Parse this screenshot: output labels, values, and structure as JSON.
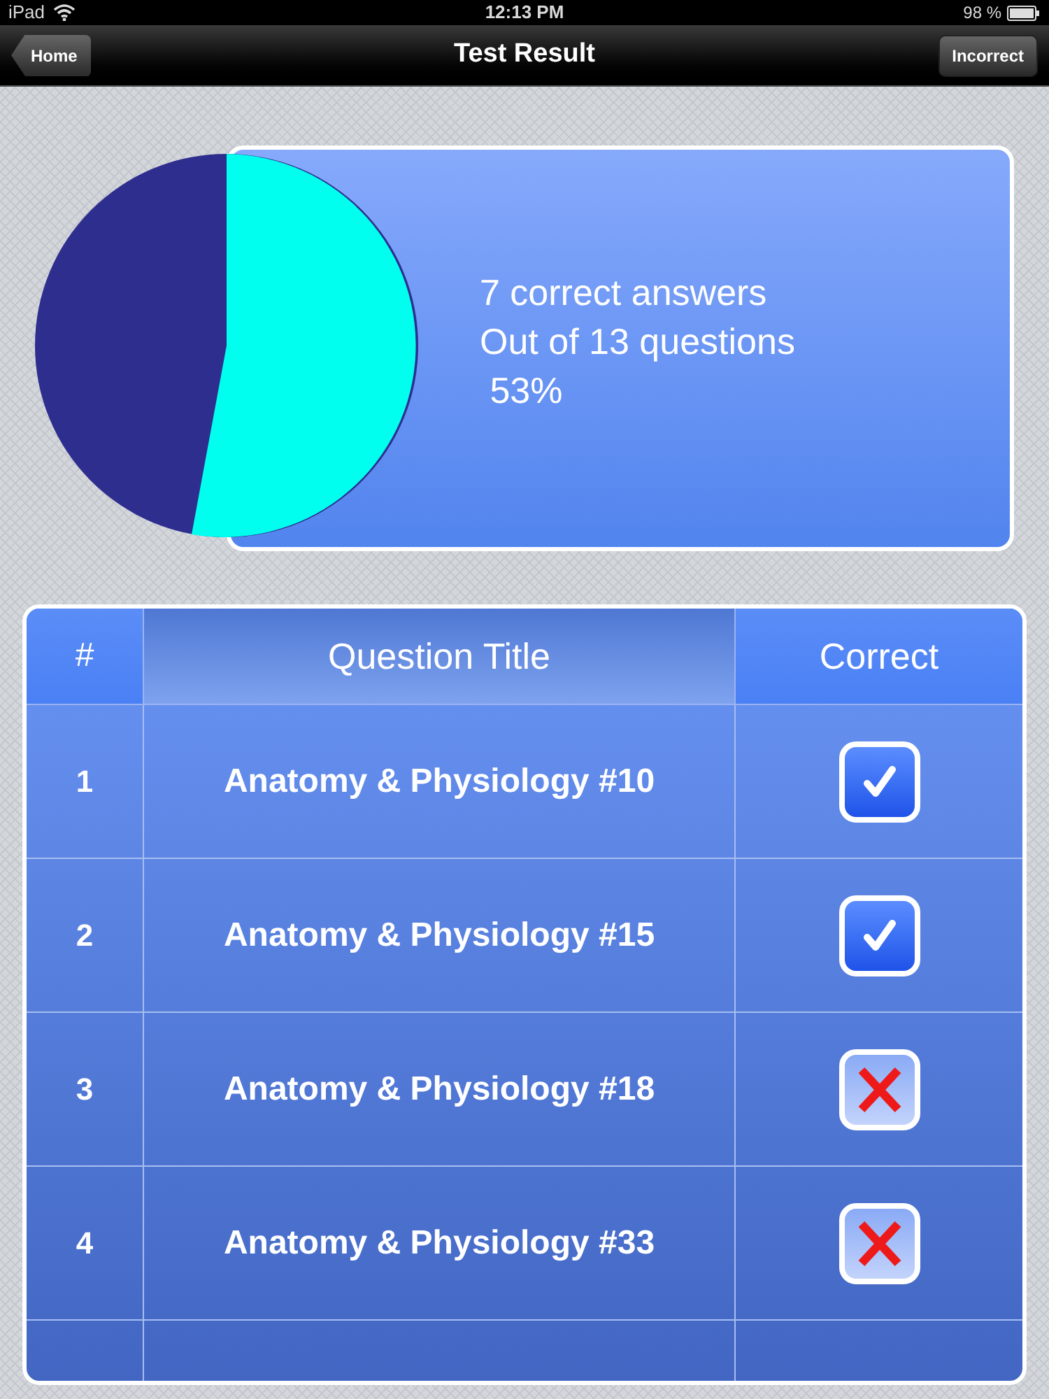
{
  "status_bar": {
    "device": "iPad",
    "time": "12:13 PM",
    "battery": "98 %"
  },
  "nav_bar": {
    "back": "Home",
    "title": "Test Result",
    "action": "Incorrect"
  },
  "summary": {
    "lines": [
      "7 correct answers",
      "Out of 13 questions",
      " 53%"
    ]
  },
  "table": {
    "columns": [
      "#",
      "Question Title",
      "Correct"
    ],
    "rows": [
      {
        "number": "1",
        "title": "Anatomy & Physiology #10",
        "correct": true
      },
      {
        "number": "2",
        "title": "Anatomy & Physiology #15",
        "correct": true
      },
      {
        "number": "3",
        "title": "Anatomy & Physiology #18",
        "correct": false
      },
      {
        "number": "4",
        "title": "Anatomy & Physiology #33",
        "correct": false
      }
    ]
  }
}
